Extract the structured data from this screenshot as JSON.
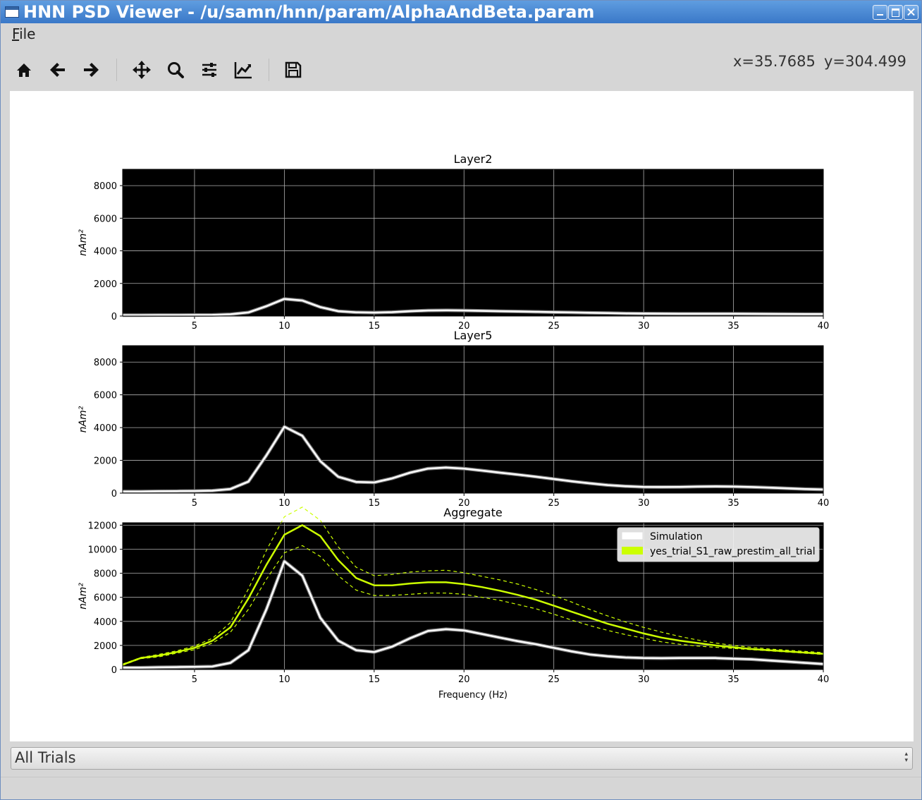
{
  "window": {
    "title": "HNN PSD Viewer - /u/samn/hnn/param/AlphaAndBeta.param",
    "buttons": [
      "minimize",
      "maximize",
      "close"
    ]
  },
  "menu": {
    "file_label": "File",
    "file_mnemonic": "F",
    "file_rest": "ile"
  },
  "toolbar": {
    "tools": [
      {
        "name": "home-icon"
      },
      {
        "name": "back-arrow-icon"
      },
      {
        "name": "forward-arrow-icon"
      },
      {
        "name": "pan-move-icon"
      },
      {
        "name": "zoom-icon"
      },
      {
        "name": "subplots-config-icon"
      },
      {
        "name": "axes-edit-icon"
      },
      {
        "name": "save-icon"
      }
    ],
    "coord_x": "x=35.7685",
    "coord_y": "y=304.499"
  },
  "colors": {
    "simulation": "#ffffff",
    "data": "#ccff00",
    "plot_bg": "#000000"
  },
  "chart_data": [
    {
      "type": "line",
      "title": "Layer2",
      "ylabel": "nAm²",
      "xlim": [
        1,
        40
      ],
      "ylim": [
        0,
        9000
      ],
      "xticks": [
        5,
        10,
        15,
        20,
        25,
        30,
        35,
        40
      ],
      "yticks": [
        0,
        2000,
        4000,
        6000,
        8000
      ],
      "grid": true,
      "x": [
        1,
        2,
        3,
        4,
        5,
        6,
        7,
        8,
        9,
        10,
        11,
        12,
        13,
        14,
        15,
        16,
        17,
        18,
        19,
        20,
        21,
        22,
        23,
        24,
        25,
        26,
        27,
        28,
        29,
        30,
        31,
        32,
        33,
        34,
        35,
        36,
        37,
        38,
        39,
        40
      ],
      "series": [
        {
          "values": [
            50,
            55,
            60,
            60,
            65,
            70,
            110,
            220,
            600,
            1050,
            950,
            550,
            300,
            230,
            210,
            240,
            300,
            340,
            350,
            340,
            320,
            300,
            280,
            260,
            240,
            220,
            200,
            180,
            160,
            150,
            145,
            140,
            140,
            140,
            140,
            135,
            130,
            125,
            120,
            115
          ]
        }
      ]
    },
    {
      "type": "line",
      "title": "Layer5",
      "ylabel": "nAm²",
      "xlim": [
        1,
        40
      ],
      "ylim": [
        0,
        9000
      ],
      "xticks": [
        5,
        10,
        15,
        20,
        25,
        30,
        35,
        40
      ],
      "yticks": [
        0,
        2000,
        4000,
        6000,
        8000
      ],
      "grid": true,
      "x": [
        1,
        2,
        3,
        4,
        5,
        6,
        7,
        8,
        9,
        10,
        11,
        12,
        13,
        14,
        15,
        16,
        17,
        18,
        19,
        20,
        21,
        22,
        23,
        24,
        25,
        26,
        27,
        28,
        29,
        30,
        31,
        32,
        33,
        34,
        35,
        36,
        37,
        38,
        39,
        40
      ],
      "series": [
        {
          "values": [
            100,
            100,
            110,
            120,
            130,
            150,
            250,
            700,
            2300,
            4050,
            3500,
            1950,
            1000,
            680,
            650,
            900,
            1250,
            1500,
            1560,
            1500,
            1380,
            1250,
            1130,
            1000,
            860,
            720,
            600,
            490,
            420,
            380,
            370,
            380,
            400,
            410,
            400,
            370,
            330,
            290,
            250,
            220
          ]
        }
      ]
    },
    {
      "type": "line",
      "title": "Aggregate",
      "xlabel": "Frequency (Hz)",
      "ylabel": "nAm²",
      "xlim": [
        1,
        40
      ],
      "ylim": [
        0,
        12200
      ],
      "xticks": [
        5,
        10,
        15,
        20,
        25,
        30,
        35,
        40
      ],
      "yticks": [
        0,
        2000,
        4000,
        6000,
        8000,
        10000,
        12000
      ],
      "grid": true,
      "legend": "top-right",
      "x": [
        1,
        2,
        3,
        4,
        5,
        6,
        7,
        8,
        9,
        10,
        11,
        12,
        13,
        14,
        15,
        16,
        17,
        18,
        19,
        20,
        21,
        22,
        23,
        24,
        25,
        26,
        27,
        28,
        29,
        30,
        31,
        32,
        33,
        34,
        35,
        36,
        37,
        38,
        39,
        40
      ],
      "series": [
        {
          "name": "Simulation",
          "values": [
            150,
            150,
            180,
            200,
            220,
            250,
            550,
            1600,
            5000,
            9000,
            7800,
            4300,
            2400,
            1600,
            1450,
            1900,
            2600,
            3200,
            3350,
            3250,
            2950,
            2650,
            2350,
            2100,
            1800,
            1500,
            1250,
            1100,
            1000,
            950,
            940,
            950,
            950,
            950,
            900,
            850,
            750,
            650,
            550,
            450
          ]
        },
        {
          "name": "yes_trial_S1_raw_prestim_all_trial",
          "values": [
            400,
            950,
            1150,
            1450,
            1800,
            2400,
            3500,
            5900,
            8700,
            11200,
            12000,
            11100,
            9100,
            7600,
            7000,
            7000,
            7150,
            7250,
            7250,
            7100,
            6850,
            6550,
            6200,
            5800,
            5300,
            4800,
            4300,
            3800,
            3400,
            3000,
            2650,
            2400,
            2200,
            2000,
            1850,
            1700,
            1600,
            1500,
            1400,
            1300
          ]
        },
        {
          "name": "upper-bound",
          "values": [
            450,
            1000,
            1250,
            1550,
            1950,
            2600,
            3900,
            6700,
            9900,
            12700,
            13500,
            12400,
            10200,
            8500,
            7800,
            7900,
            8100,
            8200,
            8250,
            8050,
            7750,
            7450,
            7100,
            6650,
            6150,
            5600,
            5000,
            4450,
            3950,
            3500,
            3100,
            2750,
            2450,
            2200,
            2000,
            1850,
            1700,
            1600,
            1500,
            1400
          ]
        },
        {
          "name": "lower-bound",
          "values": [
            350,
            900,
            1050,
            1350,
            1650,
            2200,
            3100,
            5000,
            7500,
            9700,
            10300,
            9400,
            7800,
            6600,
            6150,
            6150,
            6250,
            6350,
            6350,
            6250,
            6000,
            5750,
            5400,
            5050,
            4600,
            4100,
            3650,
            3250,
            2900,
            2600,
            2300,
            2100,
            1950,
            1850,
            1750,
            1650,
            1550,
            1450,
            1350,
            1250
          ]
        }
      ]
    }
  ],
  "combo": {
    "value": "All Trials"
  }
}
